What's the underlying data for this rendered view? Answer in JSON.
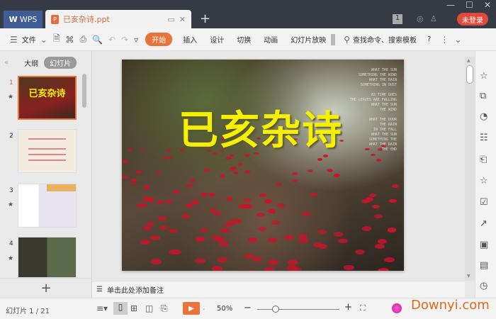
{
  "titlebar": {
    "wps_tab": "WPS",
    "doc_tab": "已亥杂诗.ppt",
    "login": "未登录",
    "badge": "1"
  },
  "toolbar": {
    "file": "文件",
    "tabs": [
      "开始",
      "插入",
      "设计",
      "切换",
      "动画",
      "幻灯片放映"
    ],
    "search": "查找命令、搜索模板",
    "help": "?"
  },
  "left_panel": {
    "tab_outline": "大纲",
    "tab_slides": "幻灯片",
    "slides": [
      "1",
      "2",
      "3",
      "4"
    ],
    "slide1_title": "已亥杂诗"
  },
  "slide": {
    "title": "已亥杂诗",
    "english": "WHAT THE SUN\nSOMETHING THE WIND\nWHAT THE RAIN\nSOMETHING IN DUST\n\nAS TIME GOES\nTHE LEAVES ARE FALLING\nWHAT THE SUN\nTHE WIND\n\nWHAT THE DOOR\nTHE RAIN\nIN THE FALL\nWHAT THE SUN\nSOMETHING THE\nWHAT THE RAIN\nTHE END"
  },
  "notes": {
    "placeholder": "单击此处添加备注"
  },
  "status": {
    "slide_counter": "幻灯片 1 / 21",
    "zoom": "50%",
    "watermark": "Downyi.com"
  },
  "colors": {
    "accent": "#e8743b",
    "titlebar": "#363a45",
    "login": "#e04a3a"
  }
}
